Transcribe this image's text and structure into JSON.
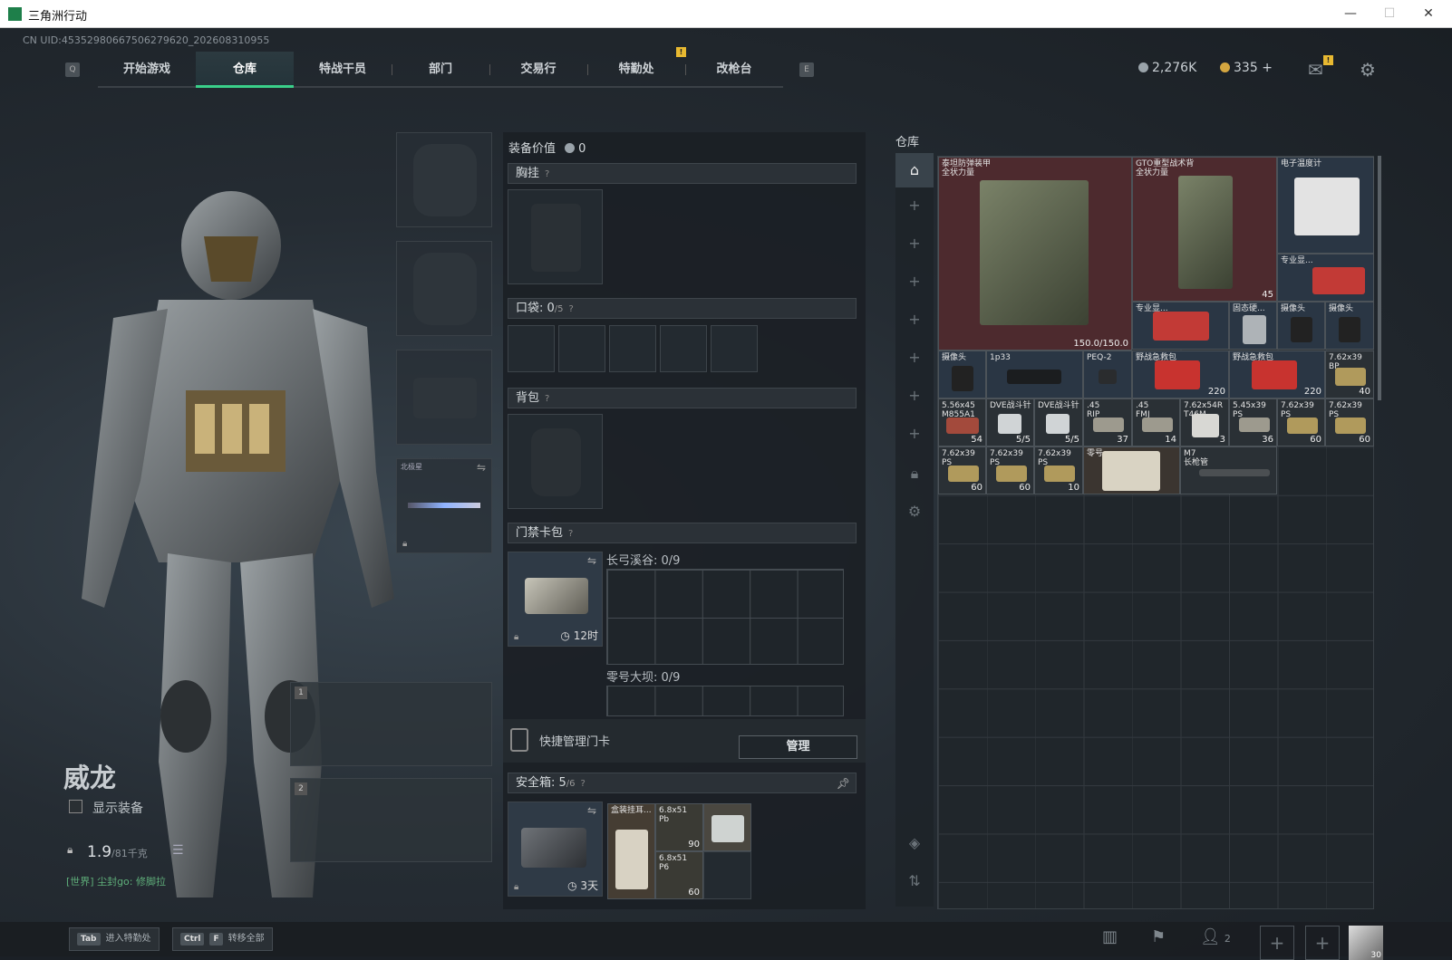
{
  "window": {
    "title": "三角洲行动",
    "min": "—",
    "max": "☐",
    "close": "✕"
  },
  "uid": "CN UID:4535298066750627962​0_202608310955",
  "nav": {
    "key_left": "Q",
    "key_right": "E",
    "tabs": [
      "开始游戏",
      "仓库",
      "特战干员",
      "部门",
      "交易行",
      "特勤处",
      "改枪台"
    ],
    "active": 1
  },
  "currency": {
    "silver": "2,276K",
    "gold": "335",
    "plus": "+",
    "silver_color": "#9aa3aa",
    "gold_color": "#d4a640"
  },
  "badges": {
    "mail": "!",
    "nav": "!"
  },
  "character": {
    "name": "威龙",
    "show_equip": "显示装备",
    "weight": "1.9",
    "weight_max": "/81千克",
    "chat": "[世界] 尘封go: 修脚拉"
  },
  "weapon_slot": {
    "label": "北极星"
  },
  "weapon_nums": [
    "1",
    "2"
  ],
  "loadout": {
    "value_label": "装备价值",
    "value": "0",
    "chest": "胸挂",
    "pocket": "口袋: ",
    "pocket_count": "0",
    "pocket_max": "/5",
    "backpack": "背包",
    "keycard": "门禁卡包",
    "key_zone1": "长弓溪谷: 0/9",
    "key_zone2": "零号大坝: 0/9",
    "key_time": "12时",
    "quick_manage": "快捷管理门卡",
    "manage_btn": "管理",
    "safebox": "安全箱: ",
    "safe_count": "5",
    "safe_max": "/6",
    "safe_time": "3天",
    "safe_items": [
      {
        "name": "盒装挂耳...",
        "count": ""
      },
      {
        "name": "6.8x51\nPb",
        "count": "90"
      },
      {
        "name": "",
        "count": ""
      },
      {
        "name": "6.8x51\nP6",
        "count": "60"
      }
    ]
  },
  "storage": {
    "title": "仓库",
    "items": [
      {
        "name": "泰坦防弹装甲\n全状力量",
        "count": "150.0/150.0",
        "style": "red"
      },
      {
        "name": "GTO重型战术背\n全状力量",
        "count": "45",
        "style": "red"
      },
      {
        "name": "电子温度计",
        "count": "",
        "style": "blue"
      },
      {
        "name": "专业显...",
        "count": "",
        "style": "blue"
      },
      {
        "name": "专业显...",
        "count": "",
        "style": "blue"
      },
      {
        "name": "固态硬...",
        "count": "",
        "style": "blue"
      },
      {
        "name": "摄像头",
        "count": "",
        "style": "blue"
      },
      {
        "name": "摄像头",
        "count": "",
        "style": "blue"
      },
      {
        "name": "摄像头",
        "count": "",
        "style": "blue"
      },
      {
        "name": "1p33",
        "count": "",
        "style": "blue"
      },
      {
        "name": "PEQ-2",
        "count": "",
        "style": "blue"
      },
      {
        "name": "野战急救包",
        "count": "220",
        "style": "blue"
      },
      {
        "name": "野战急救包",
        "count": "220",
        "style": "blue"
      },
      {
        "name": "7.62x39\nBP",
        "count": "40",
        "style": ""
      },
      {
        "name": "5.56x45\nM855A1",
        "count": "54",
        "style": ""
      },
      {
        "name": "DVE战斗针",
        "count": "5/5",
        "style": ""
      },
      {
        "name": "DVE战斗针",
        "count": "5/5",
        "style": ""
      },
      {
        "name": ".45\nRIP",
        "count": "37",
        "style": ""
      },
      {
        "name": ".45\nFMJ",
        "count": "14",
        "style": ""
      },
      {
        "name": "7.62x54R\nT46M",
        "count": "3",
        "style": ""
      },
      {
        "name": "5.45x39\nPS",
        "count": "36",
        "style": ""
      },
      {
        "name": "7.62x39\nPS",
        "count": "60",
        "style": ""
      },
      {
        "name": "7.62x39\nPS",
        "count": "60",
        "style": ""
      },
      {
        "name": "7.62x39\nPS",
        "count": "60",
        "style": ""
      },
      {
        "name": "7.62x39\nPS",
        "count": "60",
        "style": ""
      },
      {
        "name": "7.62x39\nPS",
        "count": "10",
        "style": ""
      },
      {
        "name": "零号...",
        "count": "",
        "style": ""
      },
      {
        "name": "M7\n长枪管",
        "count": "",
        "style": ""
      }
    ]
  },
  "bottom": {
    "k1": "Tab",
    "k1_label": "进入特勤处",
    "k2a": "Ctrl",
    "k2b": "F",
    "k2_label": "转移全部",
    "team_count": "2",
    "avatar_level": "30"
  }
}
